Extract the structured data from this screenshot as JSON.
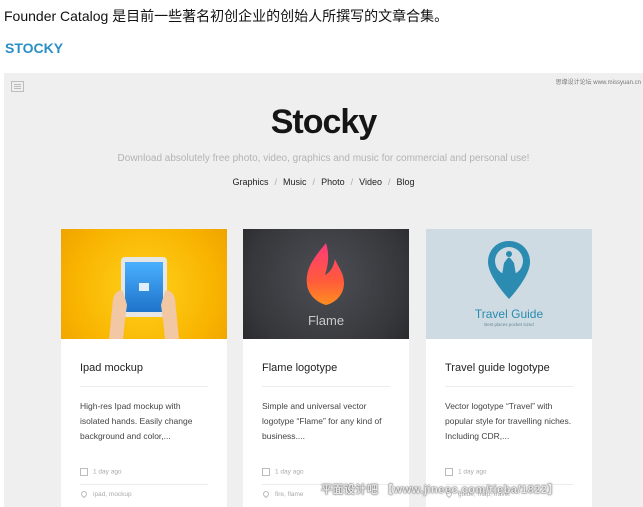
{
  "intro_text": "Founder Catalog 是目前一些著名初创企业的创始人所撰写的文章合集。",
  "section_title": "STOCKY",
  "screenshot": {
    "watermark_top": "思缘设计论坛 www.missyuan.cn",
    "brand": "Stocky",
    "tagline": "Download absolutely free photo, video, graphics and music for commercial and personal use!",
    "nav": [
      "Graphics",
      "Music",
      "Photo",
      "Video",
      "Blog"
    ],
    "nav_separator": "/",
    "cards": [
      {
        "title": "Ipad mockup",
        "description": "High-res Ipad mockup with isolated hands. Easily change background and color,...",
        "date": "1 day ago",
        "tags": "ipad, mockup",
        "image_theme": "yellow",
        "image_text": ""
      },
      {
        "title": "Flame logotype",
        "description": "Simple and universal vector logotype “Flame” for any kind of business....",
        "date": "1 day ago",
        "tags": "fire, flame",
        "image_theme": "dark",
        "image_text": "Flame"
      },
      {
        "title": "Travel guide logotype",
        "description": "Vector logotype “Travel” with popular style for travelling niches. Including CDR,...",
        "date": "1 day ago",
        "tags": "guide, map, travel",
        "image_theme": "lightblue",
        "image_text": "Travel Guide",
        "image_subtext": "Best places pocket sized"
      }
    ]
  },
  "watermark_bottom": "平面设计吧 【www.jineec.com/tieba/1822】",
  "colors": {
    "section_title": "#2a8fc7",
    "screenshot_bg": "#efefef",
    "card_yellow": "#f8b300",
    "card_dark": "#36373b",
    "card_lightblue": "#cfdbe2",
    "travel_blue": "#2b8bb0"
  }
}
